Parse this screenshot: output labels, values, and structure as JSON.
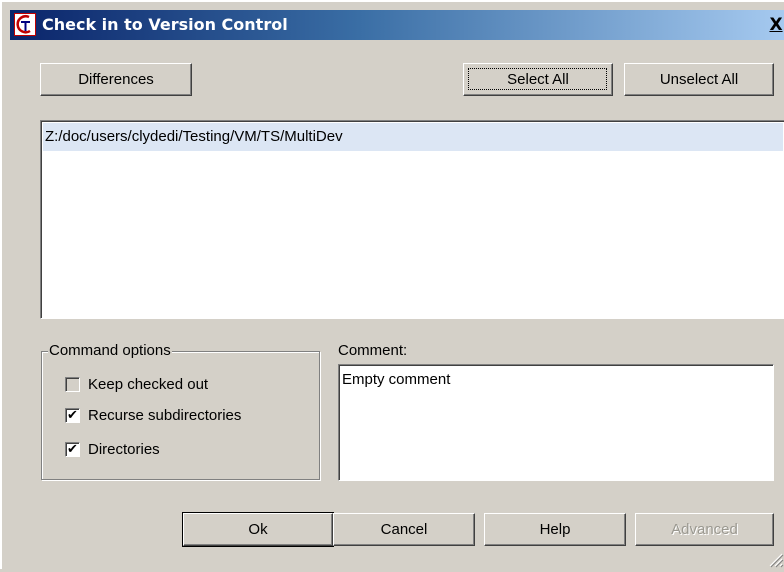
{
  "window": {
    "title": "Check in to Version Control",
    "close_label": "X"
  },
  "toolbar": {
    "differences_label": "Differences",
    "select_all_label": "Select All",
    "unselect_all_label": "Unselect All"
  },
  "file_list": {
    "items": [
      "Z:/doc/users/clydedi/Testing/VM/TS/MultiDev"
    ]
  },
  "command_options": {
    "title": "Command options",
    "options": [
      {
        "label": "Keep checked out",
        "checked": false
      },
      {
        "label": "Recurse subdirectories",
        "checked": true
      },
      {
        "label": "Directories",
        "checked": true
      }
    ]
  },
  "comment": {
    "label": "Comment:",
    "value": "Empty comment"
  },
  "footer": {
    "ok_label": "Ok",
    "cancel_label": "Cancel",
    "help_label": "Help",
    "advanced_label": "Advanced"
  },
  "colors": {
    "title_gradient_start": "#0a246a",
    "title_gradient_end": "#a6caf0",
    "dialog_face": "#d4d0c8",
    "selection_bg": "#dce6f4"
  }
}
